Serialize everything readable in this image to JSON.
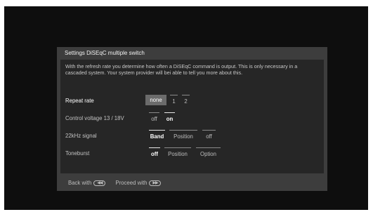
{
  "dialog": {
    "title": "Settings DiSEqC multiple switch",
    "description": "With the refresh rate you determine how often a DiSEqC command is output. This is only necessary in a cascaded system. Your system provider will bei able to tell you more about this."
  },
  "rows": [
    {
      "label": "Repeat rate",
      "options": [
        "none",
        "1",
        "2"
      ],
      "selected": "none",
      "focused": true
    },
    {
      "label": "Control voltage 13 / 18V",
      "options": [
        "off",
        "on"
      ],
      "selected": "on",
      "focused": false
    },
    {
      "label": "22kHz signal",
      "options": [
        "Band",
        "Position",
        "off"
      ],
      "selected": "Band",
      "focused": false
    },
    {
      "label": "Toneburst",
      "options": [
        "off",
        "Position",
        "Option"
      ],
      "selected": "off",
      "focused": false
    }
  ],
  "footer": {
    "back_label": "Back with",
    "back_icon": "rewind-button-icon",
    "proceed_label": "Proceed with",
    "proceed_icon": "fast-forward-button-icon"
  },
  "colors": {
    "screen_background": "#0e0e0e",
    "dialog_background": "#3d3d3d",
    "content_background": "#262626",
    "focus_highlight": "#6b6b6b"
  }
}
